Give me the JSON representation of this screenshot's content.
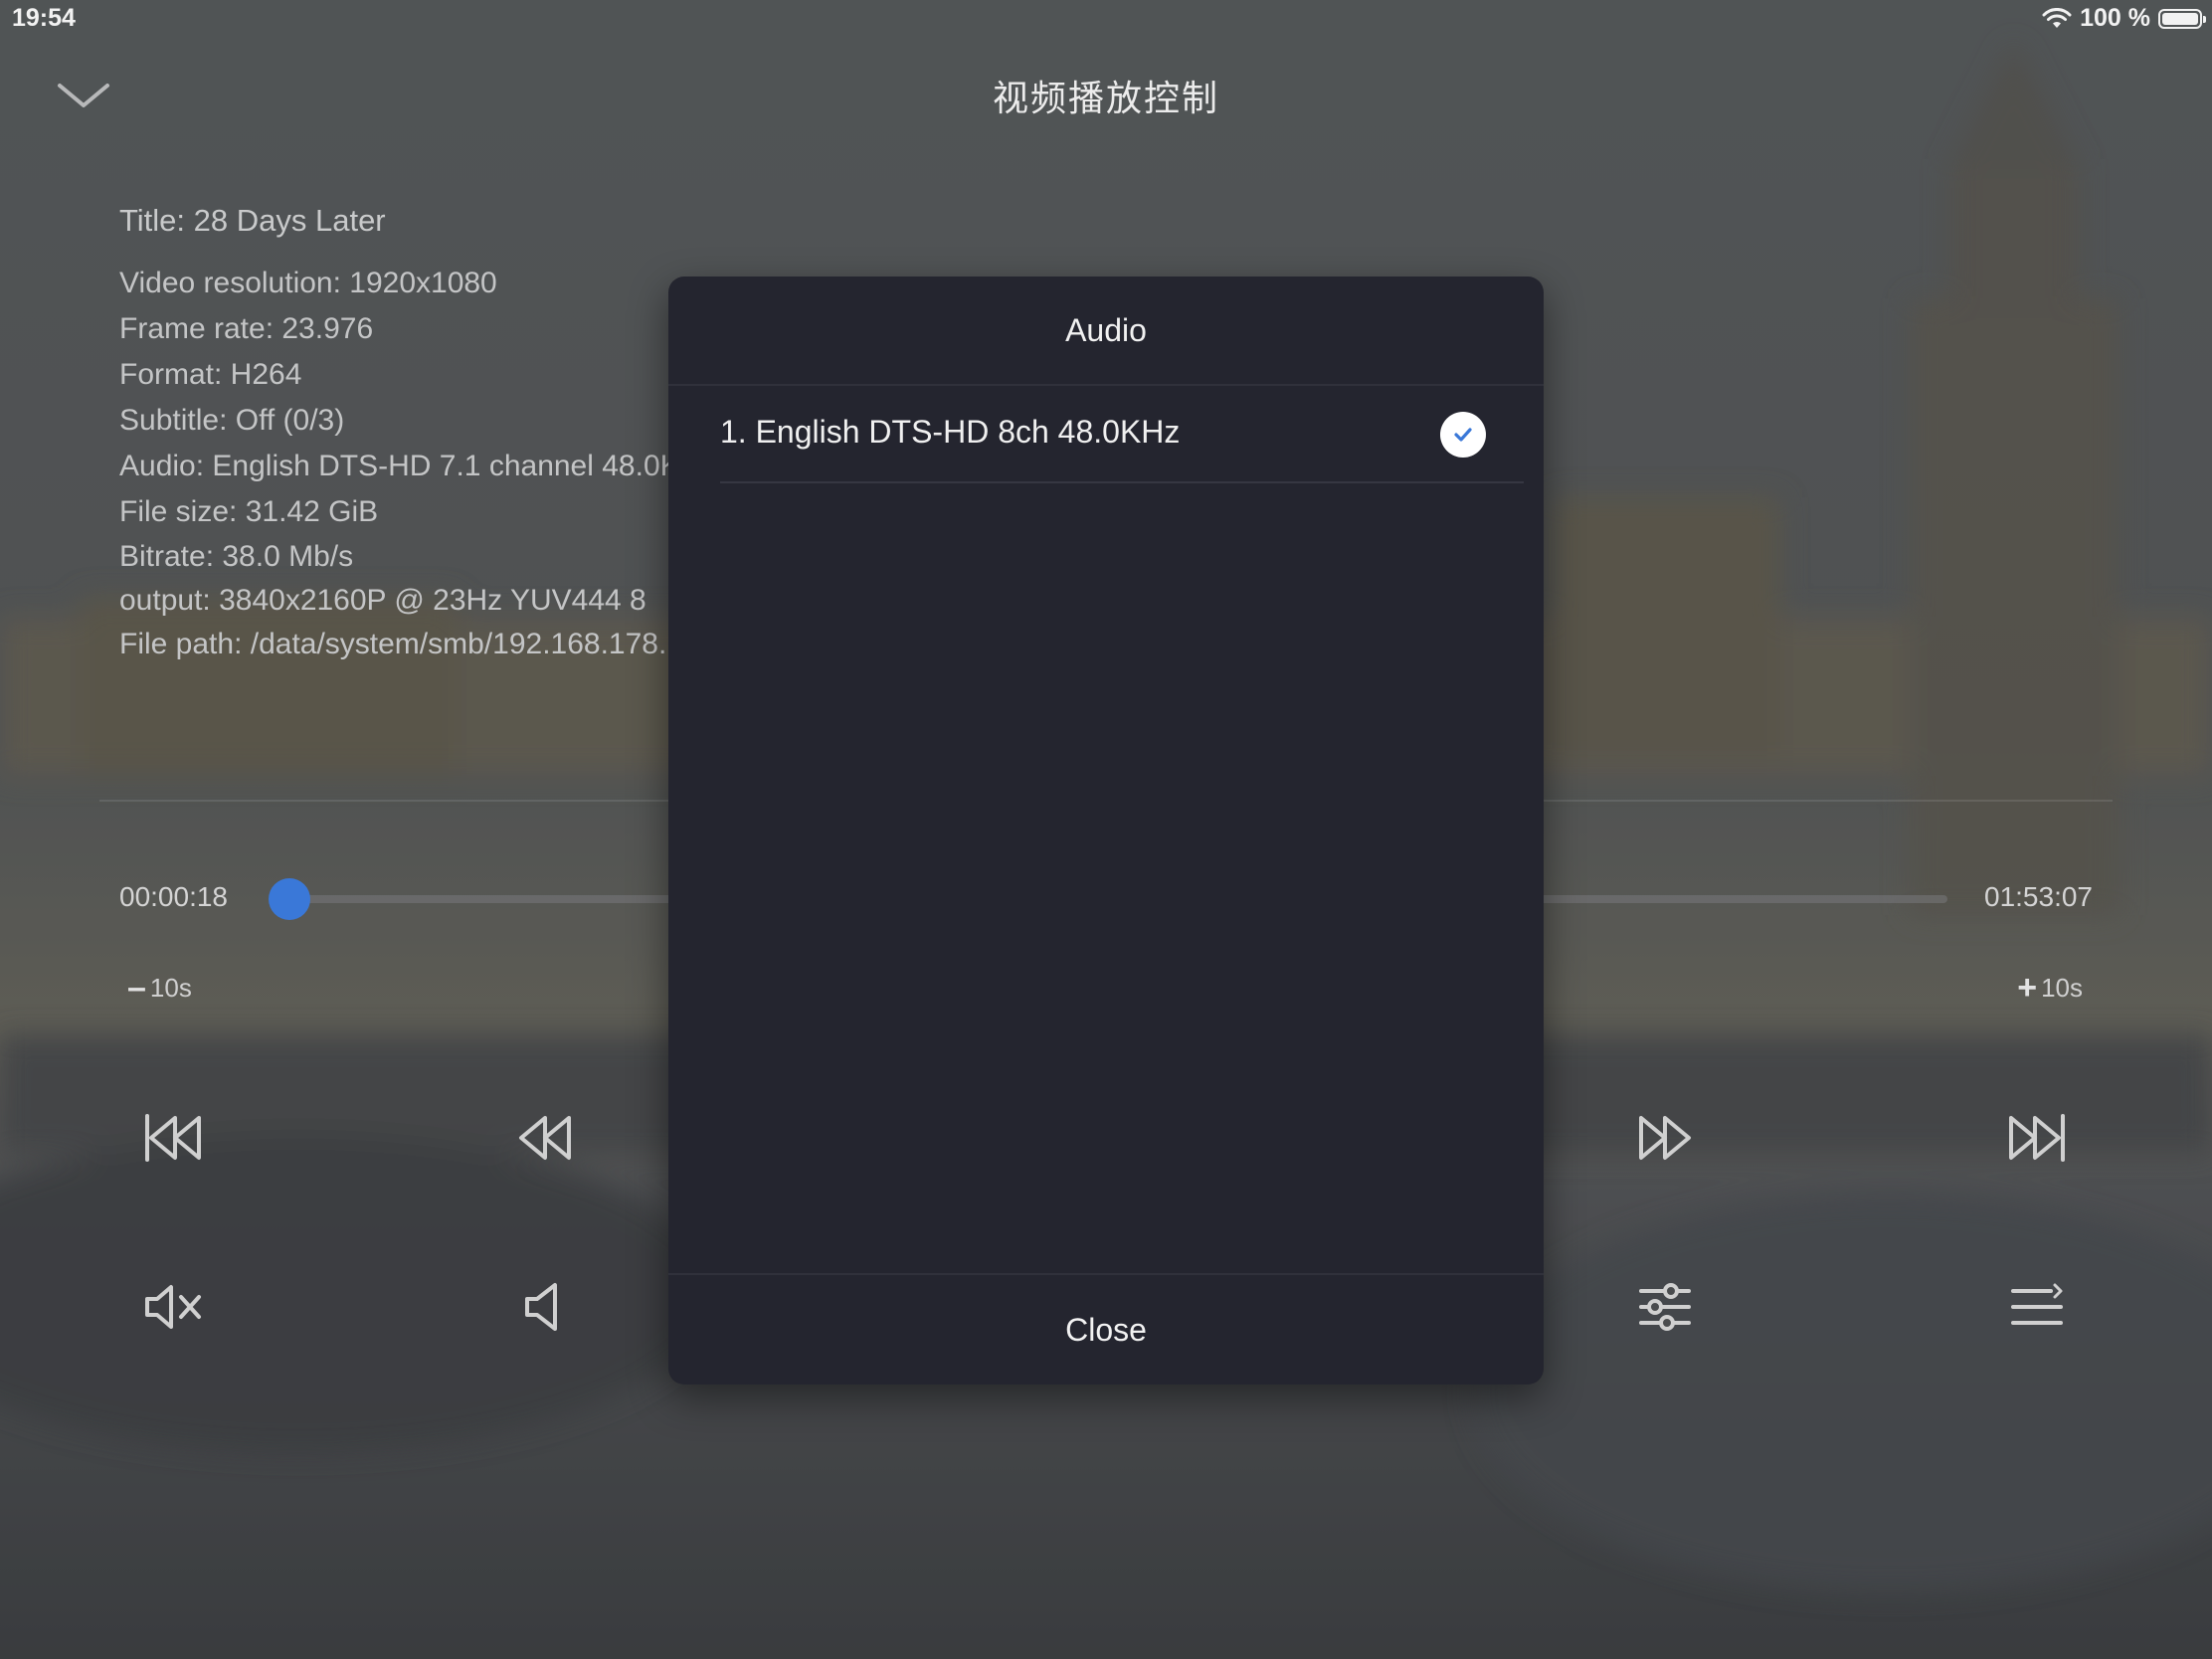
{
  "status_bar": {
    "time": "19:54",
    "battery": "100 %"
  },
  "header": {
    "title": "视频播放控制"
  },
  "info": {
    "title": "Title: 28 Days Later",
    "lines": [
      "Video resolution: 1920x1080",
      "Frame rate: 23.976",
      "Format: H264",
      "Subtitle: Off (0/3)",
      "Audio: English DTS-HD 7.1 channel 48.0K",
      "File size: 31.42 GiB",
      "Bitrate: 38.0 Mb/s",
      "output: 3840x2160P @ 23Hz  YUV444  8",
      "File path: /data/system/smb/192.168.178."
    ]
  },
  "playback": {
    "current": "00:00:18",
    "total": "01:53:07",
    "progress": 0.003,
    "accent": "#3a78d8",
    "skip_back": "10s",
    "skip_forward": "10s"
  },
  "controls": [
    "skip-previous-icon",
    "rewind-icon",
    "fast-forward-icon",
    "skip-next-icon",
    "mute-icon",
    "volume-down-icon",
    "equalizer-icon",
    "playlist-icon"
  ],
  "dialog": {
    "title": "Audio",
    "options": [
      {
        "label": "1. English DTS-HD 8ch 48.0KHz",
        "selected": true
      }
    ],
    "close_label": "Close"
  }
}
